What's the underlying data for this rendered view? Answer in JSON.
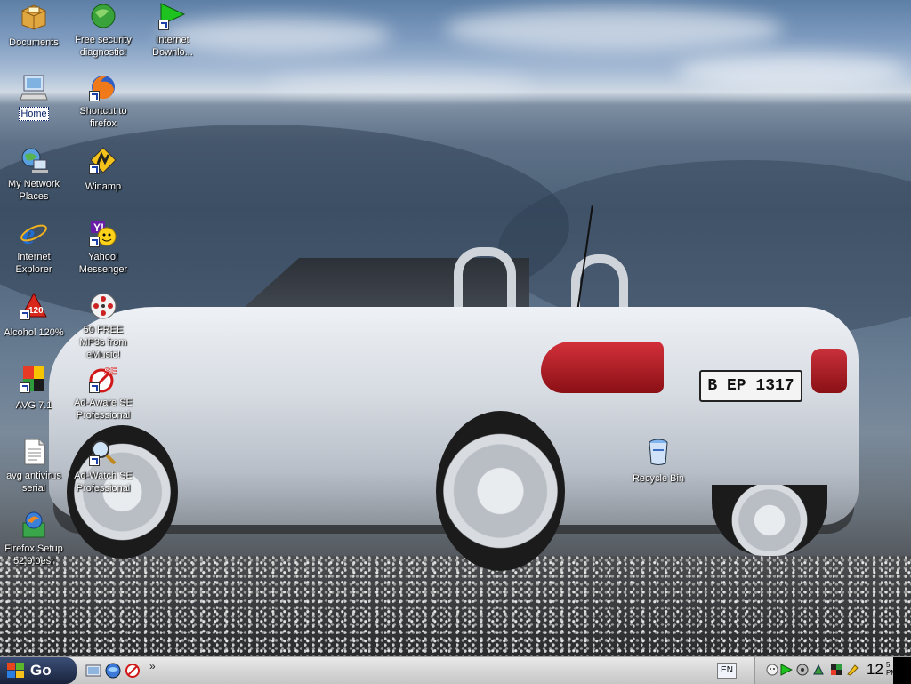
{
  "desktop": {
    "icons": [
      {
        "label": "Documents"
      },
      {
        "label": "Free security diagnostic!"
      },
      {
        "label": "Internet Downlo..."
      },
      {
        "label": "Home"
      },
      {
        "label": "Shortcut to firefox"
      },
      {
        "label": "My Network Places"
      },
      {
        "label": "Winamp"
      },
      {
        "label": "Internet Explorer"
      },
      {
        "label": "Yahoo! Messenger"
      },
      {
        "label": "Alcohol 120%"
      },
      {
        "label": "50 FREE MP3s from eMusic!"
      },
      {
        "label": "AVG 7.1"
      },
      {
        "label": "Ad-Aware SE Professional"
      },
      {
        "label": "avg antivirus serial"
      },
      {
        "label": "Ad-Watch SE Professional"
      },
      {
        "label": "Firefox Setup 52.9.0esr"
      },
      {
        "label": "Recycle Bin"
      }
    ],
    "wallpaper": {
      "plate_text": "B EP 1317"
    }
  },
  "taskbar": {
    "start_label": "Go",
    "quick_launch": [
      "show-desktop-icon",
      "browser-icon",
      "adaware-icon"
    ],
    "overflow": "»",
    "language": "EN",
    "tray_icons": [
      "messenger-icon",
      "winamp-agent-icon",
      "update-icon",
      "network-icon",
      "security-icon",
      "edit-icon"
    ],
    "clock_time": "12",
    "clock_ampm_top": "5",
    "clock_ampm_bottom": "PM"
  },
  "colors": {
    "start_button": "#18223b",
    "taskbar": "#d7d7d7",
    "selection": "#0a246a"
  }
}
